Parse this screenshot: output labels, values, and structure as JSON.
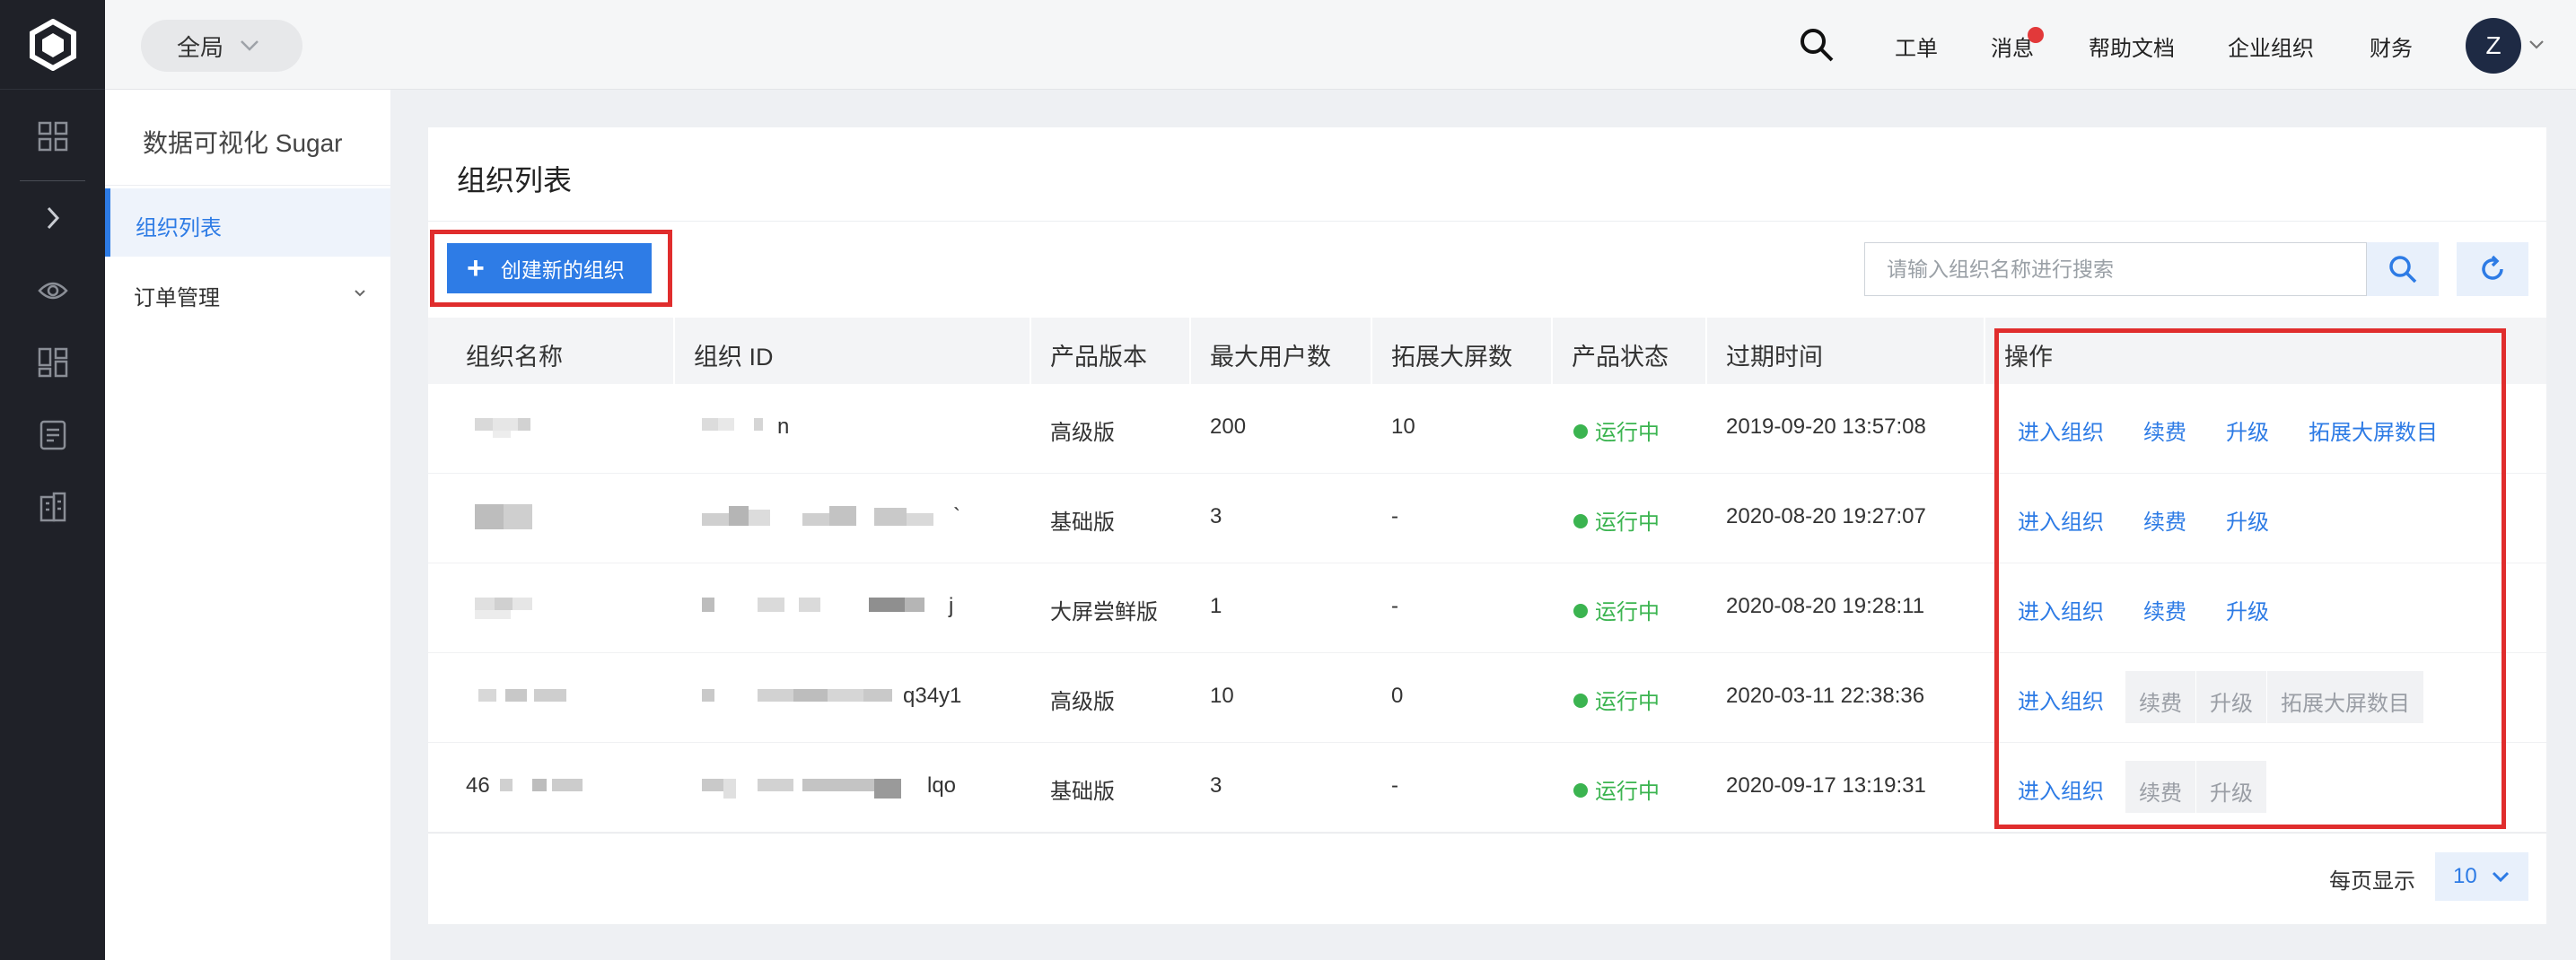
{
  "app": {
    "brand": "数据可视化 Sugar"
  },
  "topbar": {
    "scope": "全局",
    "nav": [
      "工单",
      "消息",
      "帮助文档",
      "企业组织",
      "财务"
    ],
    "avatar_initial": "Z"
  },
  "sidebar": {
    "items": [
      {
        "label": "组织列表",
        "active": true
      },
      {
        "label": "订单管理",
        "active": false
      }
    ]
  },
  "page": {
    "title": "组织列表",
    "create_button": "创建新的组织",
    "search_placeholder": "请输入组织名称进行搜索"
  },
  "table": {
    "columns": [
      "组织名称",
      "组织 ID",
      "产品版本",
      "最大用户数",
      "拓展大屏数",
      "产品状态",
      "过期时间",
      "操作"
    ],
    "rows": [
      {
        "name": "",
        "id": "n",
        "edition": "高级版",
        "max_users": "200",
        "ext_screens": "10",
        "status": "运行中",
        "expires": "2019-09-20 13:57:08",
        "actions": [
          "进入组织",
          "续费",
          "升级",
          "拓展大屏数目"
        ],
        "actions_disabled": false
      },
      {
        "name": "",
        "id": "`",
        "edition": "基础版",
        "max_users": "3",
        "ext_screens": "-",
        "status": "运行中",
        "expires": "2020-08-20 19:27:07",
        "actions": [
          "进入组织",
          "续费",
          "升级"
        ],
        "actions_disabled": false
      },
      {
        "name": "",
        "id": "j",
        "edition": "大屏尝鲜版",
        "max_users": "1",
        "ext_screens": "-",
        "status": "运行中",
        "expires": "2020-08-20 19:28:11",
        "actions": [
          "进入组织",
          "续费",
          "升级"
        ],
        "actions_disabled": false
      },
      {
        "name": "",
        "id": "q34y1",
        "edition": "高级版",
        "max_users": "10",
        "ext_screens": "0",
        "status": "运行中",
        "expires": "2020-03-11 22:38:36",
        "actions": [
          "进入组织",
          "续费",
          "升级",
          "拓展大屏数目"
        ],
        "actions_disabled": true
      },
      {
        "name": "46",
        "id": "lqo",
        "edition": "基础版",
        "max_users": "3",
        "ext_screens": "-",
        "status": "运行中",
        "expires": "2020-09-17 13:19:31",
        "actions": [
          "进入组织",
          "续费",
          "升级"
        ],
        "actions_disabled": true
      }
    ]
  },
  "pagination": {
    "per_page_label": "每页显示",
    "page_size": "10"
  },
  "colors": {
    "primary": "#2e7ce6",
    "success": "#3bb450",
    "highlight": "#e02d2d",
    "rail": "#1f2128"
  },
  "icons": [
    "logo-icon",
    "dashboard-icon",
    "expand-icon",
    "eye-icon",
    "layout-icon",
    "report-icon",
    "building-icon",
    "search-icon",
    "refresh-icon",
    "chevron-down-icon",
    "plus-icon"
  ]
}
